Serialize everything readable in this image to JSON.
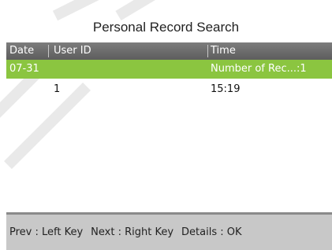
{
  "title": "Personal Record Search",
  "table": {
    "headers": {
      "date": "Date",
      "user_id": "User ID",
      "time": "Time"
    },
    "rows": [
      {
        "date": "07-31",
        "user_id": "",
        "time": "Number of Rec...:1",
        "highlighted": true
      },
      {
        "date": "",
        "user_id": "1",
        "time": "15:19",
        "highlighted": false
      }
    ]
  },
  "footer": {
    "prev": "Prev : Left Key",
    "next": "Next : Right Key",
    "details": "Details : OK"
  },
  "colors": {
    "header_bg": "#6d6d6d",
    "highlight": "#8bc540",
    "footer_bg": "#c8c8c8"
  }
}
